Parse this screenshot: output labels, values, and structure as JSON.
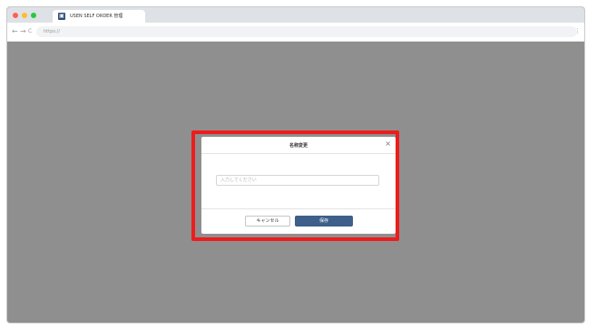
{
  "window": {
    "traffic_lights": [
      {
        "name": "close",
        "color": "#ff5f57"
      },
      {
        "name": "minimize",
        "color": "#febc2e"
      },
      {
        "name": "zoom",
        "color": "#28c840"
      }
    ]
  },
  "tab": {
    "icon": "app-icon",
    "title": "USEN SELF ORDER 管理"
  },
  "toolbar": {
    "back": "←",
    "forward": "→",
    "reload": "C",
    "url": "https://",
    "menu": "⋮"
  },
  "dialog": {
    "title": "名称変更",
    "close": "×",
    "input": {
      "value": "",
      "placeholder": "入力してください"
    },
    "cancel_label": "キャンセル",
    "save_label": "保存"
  },
  "colors": {
    "overlay": "#8f8f8f",
    "highlight": "#ee1c1c",
    "primary": "#3e5f8a"
  }
}
